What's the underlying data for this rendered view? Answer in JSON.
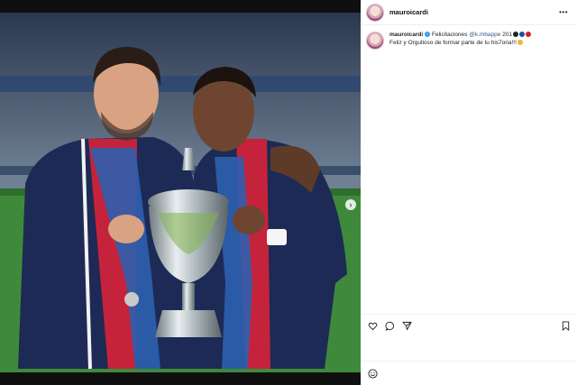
{
  "post": {
    "username": "mauroicardi",
    "verified": true,
    "caption": {
      "author": "mauroicardi",
      "part1": "Felicitaciones ",
      "mention": "@k.mbappe",
      "part2": " 201",
      "line2": "Feliz y Orgulloso de formar parte de tu his7oria!!!"
    }
  },
  "carousel": {
    "slide_count": 3,
    "current_index": 0
  },
  "icons": {
    "more": "more-horizontal-icon",
    "like": "heart-icon",
    "comment": "comment-icon",
    "share": "paper-plane-icon",
    "save": "bookmark-icon",
    "emoji": "emoji-icon",
    "next": "chevron-right-icon"
  },
  "colors": {
    "verified": "#3897f0",
    "mention": "#3a5a8c",
    "jersey": "#1c2a55"
  }
}
